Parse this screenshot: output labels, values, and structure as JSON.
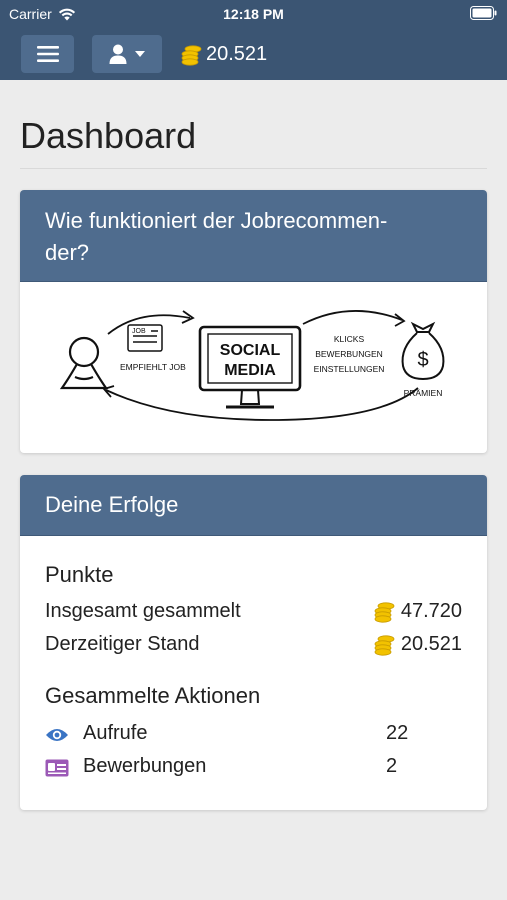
{
  "statusbar": {
    "carrier": "Carrier",
    "time": "12:18 PM"
  },
  "nav": {
    "balance": "20.521"
  },
  "page": {
    "title": "Dashboard"
  },
  "card_how": {
    "title": "Wie funktioniert der Jobrecommen-der?",
    "title_line1": "Wie funktioniert der Jobrecommen-",
    "title_line2": "der?",
    "illustration": {
      "job_label": "JOB",
      "recommends": "EMPFIEHLT JOB",
      "social": "SOCIAL",
      "media": "MEDIA",
      "clicks": "KLICKS",
      "applications": "BEWERBUNGEN",
      "settings": "EINSTELLUNGEN",
      "rewards": "PRÄMIEN"
    }
  },
  "card_success": {
    "title": "Deine Erfolge",
    "points": {
      "heading": "Punkte",
      "total_label": "Insgesamt gesammelt",
      "total_value": "47.720",
      "current_label": "Derzeitiger Stand",
      "current_value": "20.521"
    },
    "actions": {
      "heading": "Gesammelte Aktionen",
      "items": [
        {
          "label": "Aufrufe",
          "count": "22",
          "icon": "eye-icon"
        },
        {
          "label": "Bewerbungen",
          "count": "2",
          "icon": "id-card-icon"
        }
      ]
    }
  },
  "colors": {
    "navbar": "#3b5573",
    "header": "#4f6c8e",
    "coin": "#f2c200",
    "eye": "#3a74c4",
    "card_icon": "#9b59b6"
  }
}
